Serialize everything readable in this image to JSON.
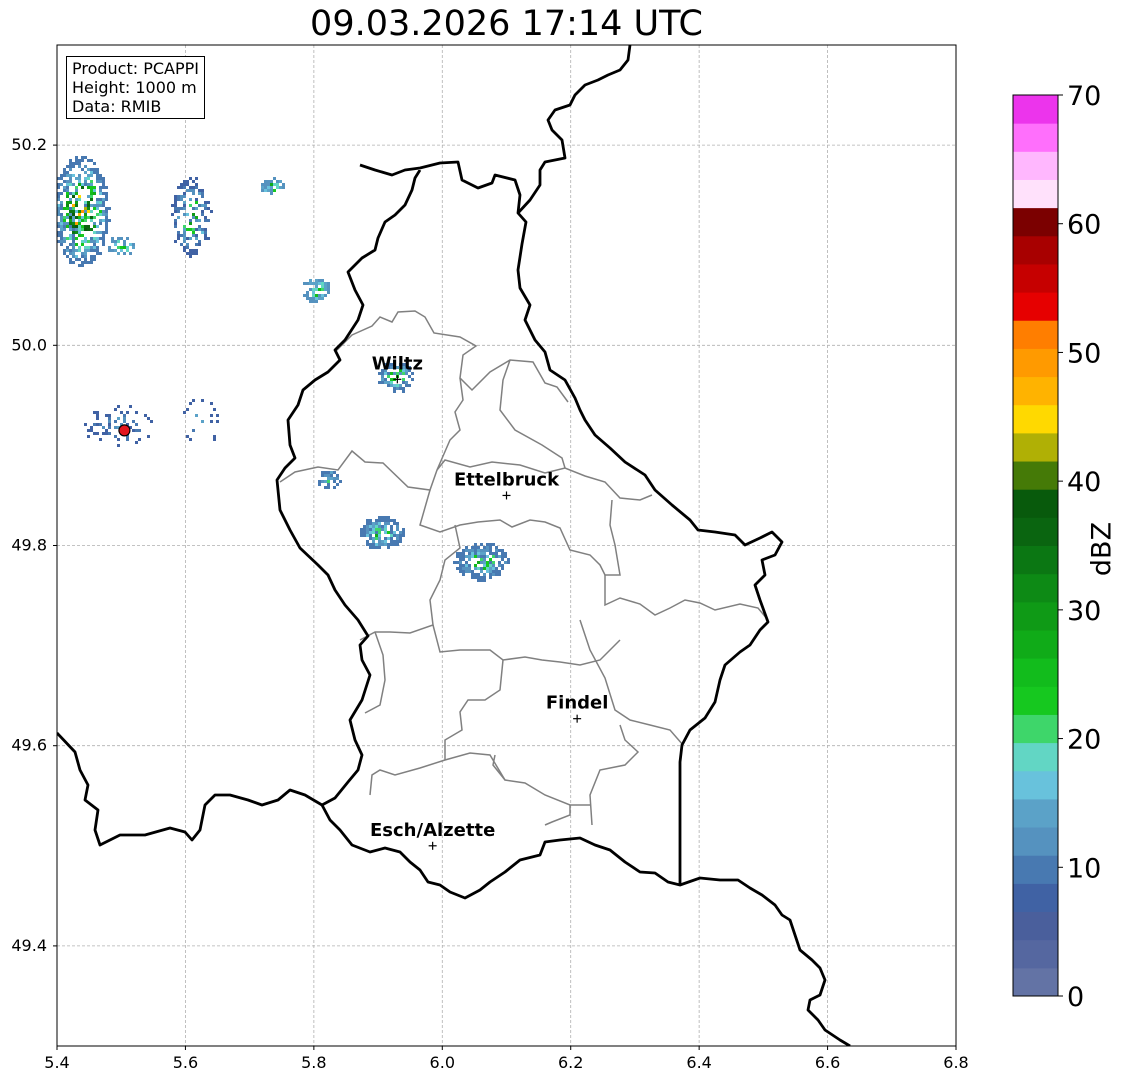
{
  "title": "09.03.2026 17:14 UTC",
  "info_box": {
    "product": "Product: PCAPPI",
    "height": "Height: 1000 m",
    "data": "Data: RMIB"
  },
  "x_ticks": [
    "5.4",
    "5.6",
    "5.8",
    "6.0",
    "6.2",
    "6.4",
    "6.6",
    "6.8"
  ],
  "y_ticks": [
    "49.4",
    "49.6",
    "49.8",
    "50.0",
    "50.2"
  ],
  "cities": [
    {
      "name": "Wiltz",
      "lon": 5.93,
      "lat": 49.966
    },
    {
      "name": "Ettelbruck",
      "lon": 6.1,
      "lat": 49.85
    },
    {
      "name": "Findel",
      "lon": 6.21,
      "lat": 49.627
    },
    {
      "name": "Esch/Alzette",
      "lon": 5.985,
      "lat": 49.5
    }
  ],
  "radar_site": {
    "lon": 5.505,
    "lat": 49.915,
    "color": "#e3161e"
  },
  "colorbar": {
    "label": "dBZ",
    "min": 0,
    "max": 70,
    "ticks": [
      "0",
      "10",
      "20",
      "30",
      "40",
      "50",
      "60",
      "70"
    ],
    "colors": [
      "#6373a5",
      "#5567a0",
      "#4a5f9c",
      "#4062a4",
      "#4879b1",
      "#5592bf",
      "#5ba2c8",
      "#68c2dc",
      "#62d6c4",
      "#3ed66a",
      "#16c81f",
      "#12bc1c",
      "#10ab18",
      "#0f9a16",
      "#0d8a15",
      "#0b7713",
      "#0a6510",
      "#085a0c",
      "#457a07",
      "#b0b005",
      "#ffd900",
      "#ffb300",
      "#ff9a00",
      "#ff7e00",
      "#e60000",
      "#c60000",
      "#a80000",
      "#7b0000",
      "#ffe1fb",
      "#ffb7fe",
      "#ff6ffc",
      "#ec34ec"
    ]
  },
  "map_extent": {
    "lon": [
      5.4,
      6.8
    ],
    "lat": [
      49.3,
      50.3
    ]
  }
}
